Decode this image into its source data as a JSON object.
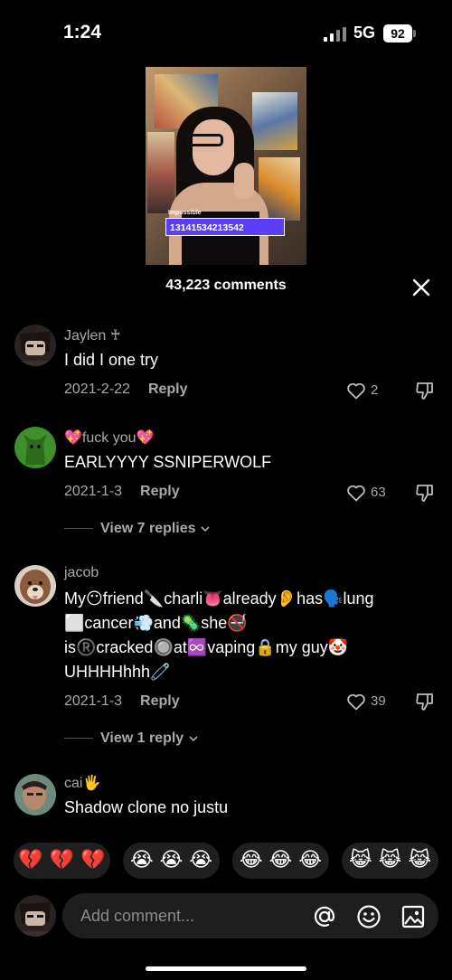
{
  "status": {
    "time": "1:24",
    "network": "5G",
    "battery": "92"
  },
  "video": {
    "caption_label": "Impossible",
    "caption_value": "13141534213542"
  },
  "header": {
    "comment_count": "43,223 comments"
  },
  "comments": [
    {
      "username": "Jaylen ♰",
      "text": "I did I one try",
      "date": "2021-2-22",
      "reply_label": "Reply",
      "likes": "2",
      "avatar_icon": "anime-avatar"
    },
    {
      "username": "💖fuck you💖",
      "text": "EARLYYYY SSNIPERWOLF",
      "date": "2021-1-3",
      "reply_label": "Reply",
      "likes": "63",
      "view_replies": "View 7 replies",
      "avatar_icon": "green-dog-avatar"
    },
    {
      "username": "jacob",
      "text": "My😶friend🔪charli👅already👂has🗣️lung ⬜cancer💨and🦠she🚭 is®️cracked🔘at♾️vaping🔒my guy🤡 UHHHHhhh🧷",
      "date": "2021-1-3",
      "reply_label": "Reply",
      "likes": "39",
      "view_replies": "View 1 reply",
      "avatar_icon": "dog-avatar"
    },
    {
      "username": "cai🖐️",
      "text": "Shadow clone no justu",
      "avatar_icon": "photo-avatar"
    }
  ],
  "emoji_bar": [
    "💔 💔 💔",
    "😭 😭 😭",
    "😂 😂 😂",
    "😹 😹 😹"
  ],
  "input": {
    "placeholder": "Add comment..."
  },
  "colors": {
    "background": "#000000",
    "secondary_text": "#a9a9a9",
    "caption_bar": "#5b3ef5"
  }
}
